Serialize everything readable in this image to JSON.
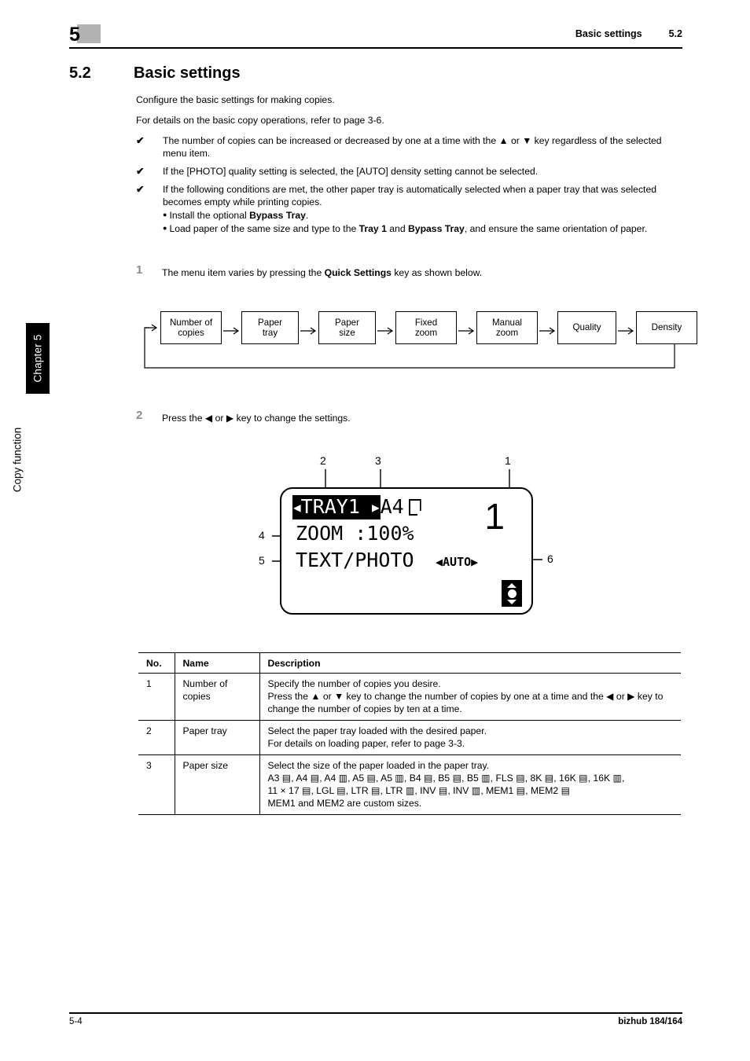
{
  "sidebar": {
    "chapter_tab": "Chapter 5",
    "function_label": "Copy function"
  },
  "header": {
    "chapter_number": "5",
    "title": "Basic settings",
    "section": "5.2"
  },
  "section": {
    "number": "5.2",
    "title": "Basic settings"
  },
  "intro": {
    "p1": "Configure the basic settings for making copies.",
    "p2": "For details on the basic copy operations, refer to page 3-6."
  },
  "bullets": [
    {
      "mark": "✔",
      "text_1": "The number of copies can be increased or decreased by one at a time with the ",
      "key_a": "▲",
      "text_2": " or ",
      "key_b": "▼",
      "text_3": " key regardless of the selected menu item."
    },
    {
      "mark": "✔",
      "text_1": "If the [PHOTO] quality setting is selected, the [AUTO] density setting cannot be selected."
    },
    {
      "mark": "✔",
      "text_1": "If the following conditions are met, the other paper tray is automatically selected when a paper tray that was selected becomes empty while printing copies.",
      "sub_1_pre": "Install the optional ",
      "sub_1_bold": "Bypass Tray",
      "sub_1_post": ".",
      "sub_2_pre": "Load paper of the same size and type to the ",
      "sub_2_bold_a": "Tray 1",
      "sub_2_mid": " and ",
      "sub_2_bold_b": "Bypass Tray",
      "sub_2_post": ", and ensure the same orientation of paper."
    }
  ],
  "steps": [
    {
      "number": "1",
      "text_pre": "The menu item varies by pressing the ",
      "text_bold": "Quick Settings",
      "text_post": " key as shown below."
    },
    {
      "number": "2",
      "text_pre": "Press the ",
      "key_a": "◀",
      "text_mid": " or ",
      "key_b": "▶",
      "text_post": " key to change the settings."
    }
  ],
  "flow": {
    "boxes": [
      "Number of\ncopies",
      "Paper\ntray",
      "Paper\nsize",
      "Fixed\nzoom",
      "Manual\nzoom",
      "Quality",
      "Density"
    ],
    "box_lines": [
      [
        "Number of",
        "copies"
      ],
      [
        "Paper",
        "tray"
      ],
      [
        "Paper",
        "size"
      ],
      [
        "Fixed",
        "zoom"
      ],
      [
        "Manual",
        "zoom"
      ],
      [
        "Quality",
        ""
      ],
      [
        "Density",
        ""
      ]
    ]
  },
  "lcd": {
    "tray": "TRAY1",
    "tray_arrow_left": "◀",
    "tray_arrow_right": "▶",
    "paper_size": "A4",
    "paper_orientation_icon": "paper-portrait-icon",
    "zoom_label": "ZOOM",
    "zoom_sep": ":",
    "zoom_value": "100%",
    "quality": "TEXT/PHOTO",
    "density": "AUTO",
    "density_arrow_left": "◀",
    "density_arrow_right": "▶",
    "copies": "1",
    "updown_icon": "up-down-scroll-icon",
    "callouts": {
      "c1": "1",
      "c2": "2",
      "c3": "3",
      "c4": "4",
      "c5": "5",
      "c6": "6"
    }
  },
  "table": {
    "headers": [
      "No.",
      "Name",
      "Description"
    ],
    "rows": [
      {
        "no": "1",
        "name": "Number of\ncopies",
        "name_line1": "Number of",
        "name_line2": "copies",
        "desc_line1": "Specify the number of copies you desire.",
        "desc_line2_pre": "Press the ",
        "desc_line2_key_a": "▲",
        "desc_line2_mid": " or ",
        "desc_line2_key_b": "▼",
        "desc_line2_post": " key to change the number of copies by one at a time and the ",
        "desc_line3_key_a": "◀",
        "desc_line3_mid": " or ",
        "desc_line3_key_b": "▶",
        "desc_line3_post": " key to change the number of copies by ten at a time."
      },
      {
        "no": "2",
        "name": "Paper tray",
        "desc_line1": "Select the paper tray loaded with the desired paper.",
        "desc_line2": "For details on loading paper, refer to page 3-3."
      },
      {
        "no": "3",
        "name": "Paper size",
        "desc_line1": "Select the size of the paper loaded in the paper tray.",
        "sizes_line1": "A3 ▤, A4 ▤, A4 ▥, A5 ▤, A5 ▥, B4 ▤, B5 ▤, B5 ▥, FLS ▤, 8K ▤, 16K ▤, 16K ▥,",
        "sizes_line2": "11 × 17 ▤, LGL ▤, LTR ▤, LTR ▥, INV ▤, INV ▥, MEM1 ▤, MEM2 ▤",
        "desc_line_last": "MEM1 and MEM2 are custom sizes."
      }
    ]
  },
  "footer": {
    "page": "5-4",
    "product": "bizhub 184/164"
  }
}
